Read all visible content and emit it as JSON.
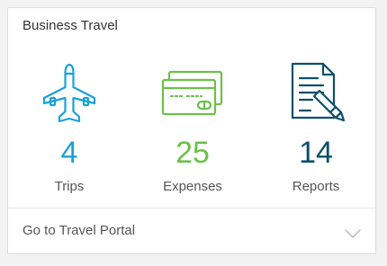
{
  "card": {
    "title": "Business Travel"
  },
  "stats": [
    {
      "icon": "airplane-icon",
      "value": "4",
      "label": "Trips",
      "color": "#1ba0d7"
    },
    {
      "icon": "credit-cards-icon",
      "value": "25",
      "label": "Expenses",
      "color": "#6cc04a"
    },
    {
      "icon": "document-pen-icon",
      "value": "14",
      "label": "Reports",
      "color": "#0d4f6b"
    }
  ],
  "footer": {
    "label": "Go to Travel Portal",
    "icon": "chevron-down-icon"
  }
}
